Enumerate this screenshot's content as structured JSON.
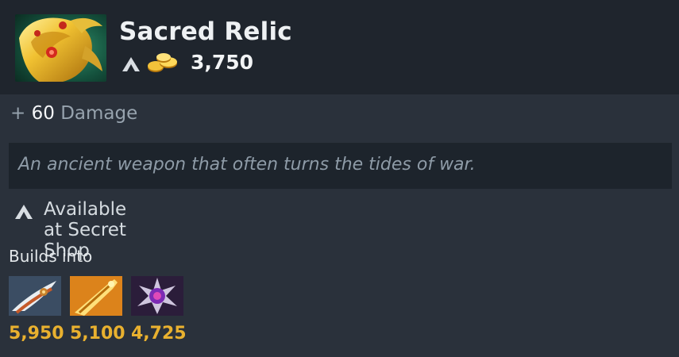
{
  "item": {
    "name": "Sacred Relic",
    "icon": "sacred-relic-icon",
    "cost": "3,750"
  },
  "stats": [
    {
      "prefix": "+",
      "value": "60",
      "label": "Damage"
    }
  ],
  "lore": "An ancient weapon that often turns the tides of war.",
  "availability": {
    "icon": "secret-shop-icon",
    "text": "Available at Secret Shop"
  },
  "builds_into": {
    "label": "Builds into",
    "items": [
      {
        "icon": "curved-blade-icon",
        "price": "5,950"
      },
      {
        "icon": "golden-sword-icon",
        "price": "5,100"
      },
      {
        "icon": "purple-gem-star-icon",
        "price": "4,725"
      }
    ]
  },
  "colors": {
    "background": "#2a313b",
    "header": "#1f252d",
    "lore_box": "#1d242c",
    "gold": "#e9b12f",
    "muted": "#97a3ae"
  }
}
